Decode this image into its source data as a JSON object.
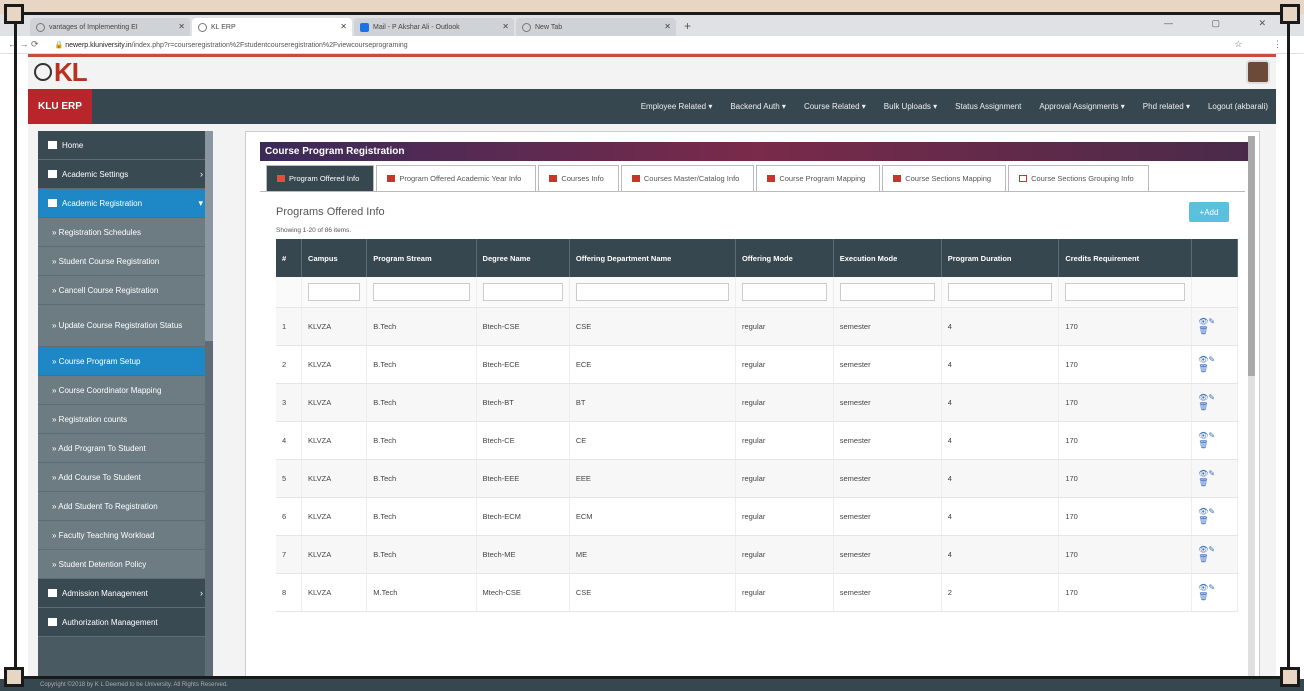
{
  "browser": {
    "tabs": [
      {
        "label": "vantages of Implementing EI",
        "active": false
      },
      {
        "label": "KL ERP",
        "active": true
      },
      {
        "label": "Mail - P Akshar Ali - Outlook",
        "active": false
      },
      {
        "label": "New Tab",
        "active": false
      }
    ],
    "url_domain": "newerp.kluniversity.in",
    "url_path": "/index.php?r=courseregistration%2Fstudentcourseregistration%2Fviewcourseprograming"
  },
  "header": {
    "logo": "KL",
    "brand": "KLU ERP",
    "menu": [
      "Employee Related ▾",
      "Backend Auth ▾",
      "Course Related ▾",
      "Bulk Uploads ▾",
      "Status Assignment",
      "Approval Assignments ▾",
      "Phd related ▾",
      "Logout (akbarali)"
    ]
  },
  "sidebar": {
    "items": [
      {
        "label": "Home",
        "type": "top"
      },
      {
        "label": "Academic Settings",
        "type": "top",
        "arrow": "›"
      },
      {
        "label": "Academic Registration",
        "type": "sel",
        "arrow": "▾"
      },
      {
        "label": "» Registration Schedules",
        "type": "sub"
      },
      {
        "label": "» Student Course Registration",
        "type": "sub"
      },
      {
        "label": "» Cancell Course Registration",
        "type": "sub"
      },
      {
        "label": "» Update Course Registration Status",
        "type": "sub tall"
      },
      {
        "label": "» Course Program Setup",
        "type": "sub active"
      },
      {
        "label": "» Course Coordinator Mapping",
        "type": "sub"
      },
      {
        "label": "» Registration counts",
        "type": "sub"
      },
      {
        "label": "» Add Program To Student",
        "type": "sub"
      },
      {
        "label": "» Add Course To Student",
        "type": "sub"
      },
      {
        "label": "» Add Student To Registration",
        "type": "sub"
      },
      {
        "label": "» Faculty Teaching Workload",
        "type": "sub"
      },
      {
        "label": "» Student Detention Policy",
        "type": "sub"
      },
      {
        "label": "Admission Management",
        "type": "top",
        "arrow": "›"
      },
      {
        "label": "Authorization Management",
        "type": "top"
      }
    ]
  },
  "main": {
    "panel_title": "Course Program Registration",
    "tabs": [
      {
        "label": "Program Offered Info",
        "active": true
      },
      {
        "label": "Program Offered Academic Year Info",
        "active": false
      },
      {
        "label": "Courses Info",
        "active": false
      },
      {
        "label": "Courses Master/Catalog Info",
        "active": false
      },
      {
        "label": "Course Program Mapping",
        "active": false
      },
      {
        "label": "Course Sections Mapping",
        "active": false
      },
      {
        "label": "Course Sections Grouping Info",
        "active": false
      }
    ],
    "section_title": "Programs Offered Info",
    "add_label": "+Add",
    "showing": "Showing 1-20 of 86 items.",
    "table": {
      "headers": [
        "#",
        "Campus",
        "Program Stream",
        "Degree Name",
        "Offering Department Name",
        "Offering Mode",
        "Execution Mode",
        "Program Duration",
        "Credits Requirement",
        ""
      ],
      "rows": [
        [
          "1",
          "KLVZA",
          "B.Tech",
          "Btech-CSE",
          "CSE",
          "regular",
          "semester",
          "4",
          "170"
        ],
        [
          "2",
          "KLVZA",
          "B.Tech",
          "Btech-ECE",
          "ECE",
          "regular",
          "semester",
          "4",
          "170"
        ],
        [
          "3",
          "KLVZA",
          "B.Tech",
          "Btech-BT",
          "BT",
          "regular",
          "semester",
          "4",
          "170"
        ],
        [
          "4",
          "KLVZA",
          "B.Tech",
          "Btech-CE",
          "CE",
          "regular",
          "semester",
          "4",
          "170"
        ],
        [
          "5",
          "KLVZA",
          "B.Tech",
          "Btech-EEE",
          "EEE",
          "regular",
          "semester",
          "4",
          "170"
        ],
        [
          "6",
          "KLVZA",
          "B.Tech",
          "Btech-ECM",
          "ECM",
          "regular",
          "semester",
          "4",
          "170"
        ],
        [
          "7",
          "KLVZA",
          "B.Tech",
          "Btech-ME",
          "ME",
          "regular",
          "semester",
          "4",
          "170"
        ],
        [
          "8",
          "KLVZA",
          "M.Tech",
          "Mtech-CSE",
          "CSE",
          "regular",
          "semester",
          "2",
          "170"
        ]
      ]
    }
  },
  "footer": "Copyright ©2018 by K L Deemed to be University. All Rights Reserved."
}
